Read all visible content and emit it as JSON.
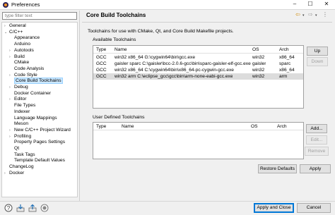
{
  "window": {
    "title": "Preferences",
    "minimize": "–",
    "maximize": "☐",
    "close": "✕"
  },
  "filter": {
    "placeholder": "type filter text"
  },
  "tree": [
    {
      "label": "General",
      "arrow": "›",
      "level": 0
    },
    {
      "label": "C/C++",
      "arrow": "⌄",
      "level": 0
    },
    {
      "label": "Appearance",
      "arrow": "",
      "level": 1
    },
    {
      "label": "Arduino",
      "arrow": "",
      "level": 1
    },
    {
      "label": "Autotools",
      "arrow": "›",
      "level": 1
    },
    {
      "label": "Build",
      "arrow": "›",
      "level": 1
    },
    {
      "label": "CMake",
      "arrow": "",
      "level": 1
    },
    {
      "label": "Code Analysis",
      "arrow": "",
      "level": 1
    },
    {
      "label": "Code Style",
      "arrow": "›",
      "level": 1
    },
    {
      "label": "Core Build Toolchains",
      "arrow": "",
      "level": 1,
      "selected": true
    },
    {
      "label": "Debug",
      "arrow": "›",
      "level": 1
    },
    {
      "label": "Docker Container",
      "arrow": "",
      "level": 1
    },
    {
      "label": "Editor",
      "arrow": "›",
      "level": 1
    },
    {
      "label": "File Types",
      "arrow": "",
      "level": 1
    },
    {
      "label": "Indexer",
      "arrow": "",
      "level": 1
    },
    {
      "label": "Language Mappings",
      "arrow": "",
      "level": 1
    },
    {
      "label": "Meson",
      "arrow": "",
      "level": 1
    },
    {
      "label": "New C/C++ Project Wizard",
      "arrow": "›",
      "level": 1
    },
    {
      "label": "Profiling",
      "arrow": "›",
      "level": 1
    },
    {
      "label": "Property Pages Settings",
      "arrow": "",
      "level": 1
    },
    {
      "label": "Qt",
      "arrow": "",
      "level": 1
    },
    {
      "label": "Task Tags",
      "arrow": "",
      "level": 1
    },
    {
      "label": "Template Default Values",
      "arrow": "",
      "level": 1
    },
    {
      "label": "ChangeLog",
      "arrow": "",
      "level": 0
    },
    {
      "label": "Docker",
      "arrow": "›",
      "level": 0
    }
  ],
  "page": {
    "title": "Core Build Toolchains",
    "description": "Toolchains for use with CMake, Qt, and Core Build Makefile projects."
  },
  "available": {
    "label": "Available Toolchains",
    "columns": [
      "Type",
      "Name",
      "OS",
      "Arch"
    ],
    "rows": [
      {
        "type": "GCC",
        "name": "win32 x86_64 G:\\cygwin64\\bin\\gcc.exe",
        "os": "win32",
        "arch": "x86_64"
      },
      {
        "type": "GCC",
        "name": "gaisler sparc C:\\gaisler\\bcc-2.0.6-gcc\\bin\\sparc-gaisler-elf-gcc.exe",
        "os": "gaisler",
        "arch": "sparc"
      },
      {
        "type": "GCC",
        "name": "win32 x86_64 C:\\cygwin64\\bin\\x86_64-pc-cygwin-gcc.exe",
        "os": "win32",
        "arch": "x86_64"
      },
      {
        "type": "GCC",
        "name": "win32 arm C:\\eclipse_gcc\\gcc\\bin\\arm-none-eabi-gcc.exe",
        "os": "win32",
        "arch": "arm",
        "selected": true
      }
    ],
    "buttons": {
      "up": "Up",
      "down": "Down"
    }
  },
  "user": {
    "label": "User Defined Toolchains",
    "columns": [
      "Type",
      "Name",
      "OS",
      "Arch"
    ],
    "buttons": {
      "add": "Add...",
      "edit": "Edit...",
      "remove": "Remove"
    }
  },
  "footer": {
    "restore_defaults": "Restore Defaults",
    "apply": "Apply",
    "apply_close": "Apply and Close",
    "cancel": "Cancel"
  },
  "colors": {
    "accent": "#0078d7",
    "selection": "#cce8ff",
    "nav_arrow": "#d08a00"
  }
}
